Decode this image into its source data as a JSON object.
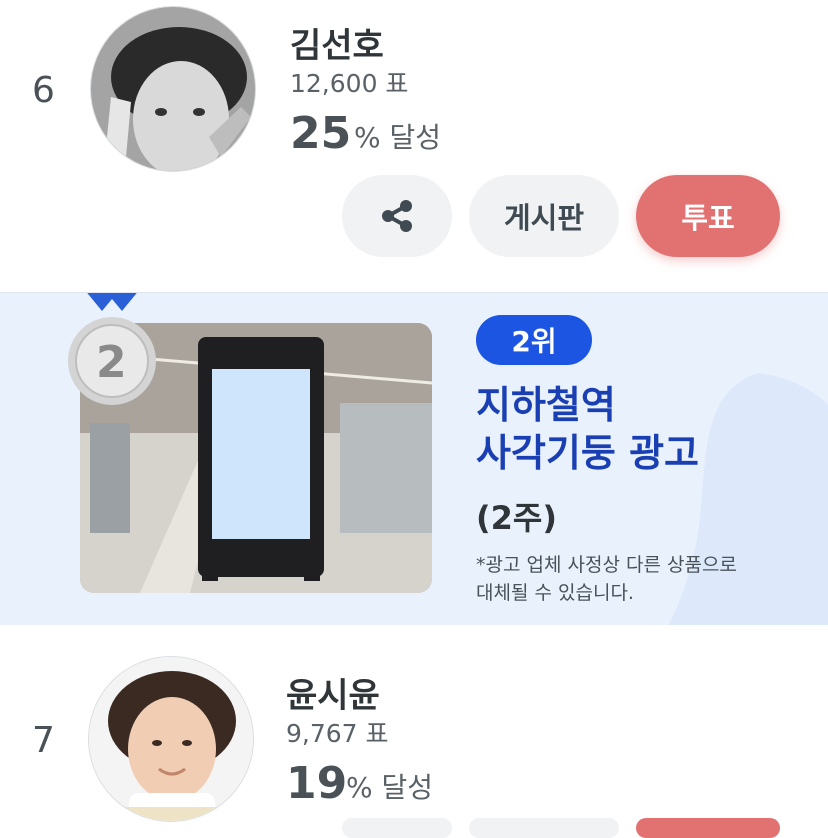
{
  "entries": [
    {
      "rank": "6",
      "name": "김선호",
      "votes": "12,600 표",
      "percent": "25",
      "percent_suffix": "% 달성"
    },
    {
      "rank": "7",
      "name": "윤시윤",
      "votes": "9,767 표",
      "percent": "19",
      "percent_suffix": "% 달성"
    }
  ],
  "actions": {
    "share_icon": "share-icon",
    "board_label": "게시판",
    "vote_label": "투표"
  },
  "banner": {
    "rank_badge": "2위",
    "medal_number": "2",
    "title_line1": "지하철역",
    "title_line2": "사각기둥 광고",
    "duration": "(2주)",
    "note_line1": "*광고 업체 사정상 다른 상품으로",
    "note_line2": "대체될 수 있습니다."
  },
  "colors": {
    "vote_button": "#e27272",
    "rank_badge": "#1d55e3",
    "banner_bg": "#e9f1fd",
    "title": "#1a3fb3"
  }
}
